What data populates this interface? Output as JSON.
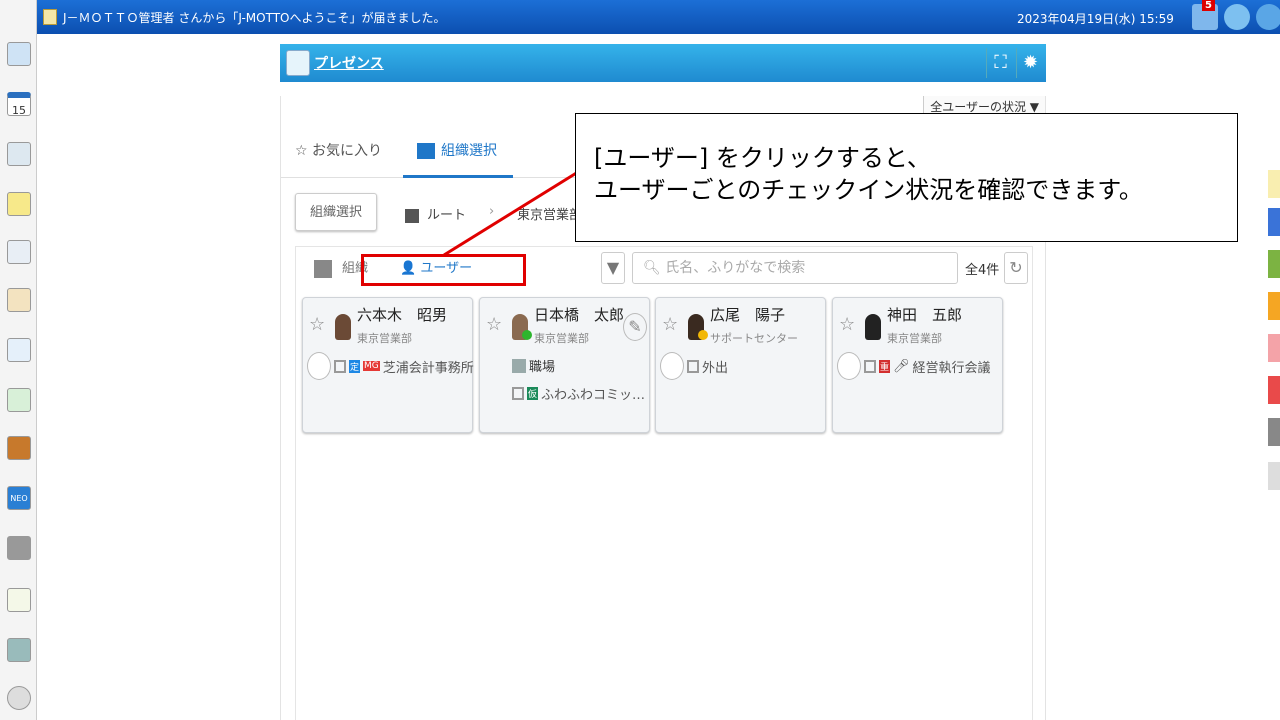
{
  "topbar": {
    "message": "J－ＭＯＴＴＯ管理者 さんから「J-MOTTOへようこそ」が届きました。",
    "datetime": "2023年04月19日(水) 15:59",
    "notification_count": "5"
  },
  "sidebar": {
    "icons": [
      "portal-icon",
      "calendar-icon",
      "facility-icon",
      "memo-icon",
      "board-icon",
      "clipboard-icon",
      "search-doc-icon",
      "recycle-icon",
      "cabinet-icon",
      "neo-icon",
      "folder-icon",
      "sticker-icon",
      "news-icon",
      "settings-icon"
    ],
    "calendar_day": "15",
    "neo_label": "NEO"
  },
  "panel": {
    "title": "プレゼンス",
    "all_status": "全ユーザーの状況 ▼",
    "tabs": [
      {
        "label": "お気に入り"
      },
      {
        "label": "組織選択"
      }
    ],
    "org_button": "組織選択",
    "breadcrumb": [
      "ルート",
      "東京営業部"
    ],
    "subtabs": [
      {
        "label": "組織"
      },
      {
        "label": "ユーザー"
      }
    ],
    "search_placeholder": "氏名、ふりがなで検索",
    "count": "全4件",
    "users": [
      {
        "name": "六本木　昭男",
        "dept": "東京営業部",
        "schedule": "芝浦会計事務所",
        "tags": [
          {
            "text": "定",
            "color": "#1e88e5"
          },
          {
            "text": "MG",
            "color": "#e53935"
          }
        ]
      },
      {
        "name": "日本橋　太郎",
        "dept": "東京営業部",
        "status": "checked-in",
        "location": "職場",
        "schedule": "ふわふわコミッ…",
        "tags": [
          {
            "text": "仮",
            "color": "#1b8a5a"
          }
        ]
      },
      {
        "name": "広尾　陽子",
        "dept": "サポートセンター",
        "status": "away",
        "schedule": "外出",
        "tags": []
      },
      {
        "name": "神田　五郎",
        "dept": "東京営業部",
        "schedule": "経営執行会議",
        "tags": [
          {
            "text": "重",
            "color": "#d32f2f"
          }
        ]
      }
    ]
  },
  "callout": {
    "line1": "[ユーザー] をクリックすると、",
    "line2": "ユーザーごとのチェックイン状況を確認できます。"
  },
  "colors": {
    "accent": "#1f77c8",
    "header": "#2aa0e0",
    "highlight": "#e00000"
  }
}
